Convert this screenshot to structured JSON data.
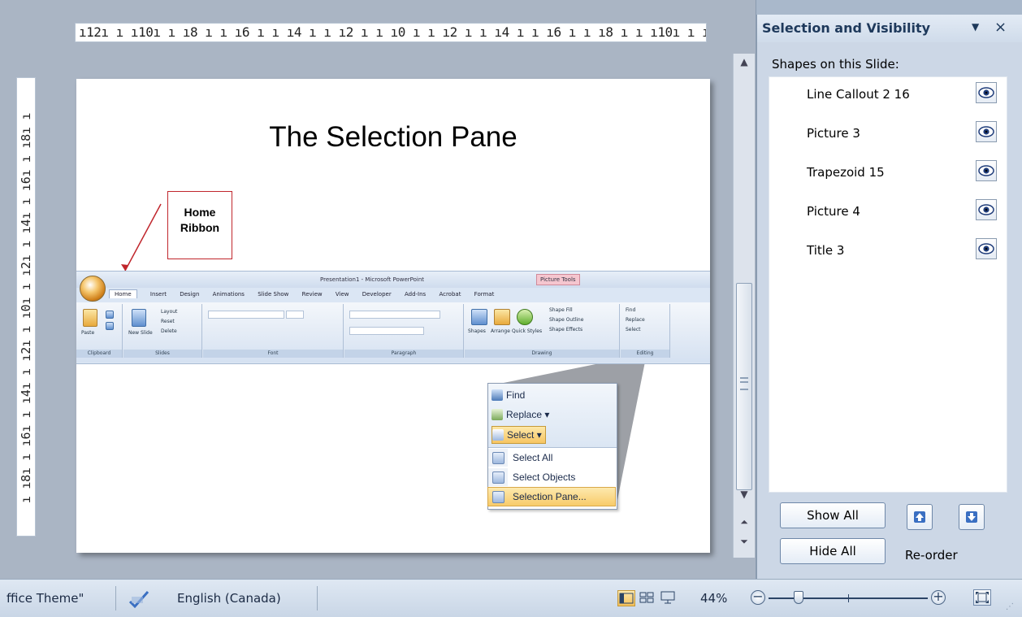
{
  "ruler": {
    "horizontal_text": "ı12ı ı ı10ı ı ı8 ı ı ı6 ı ı ı4 ı ı ı2 ı ı ı0 ı ı ı2 ı ı ı4 ı ı ı6 ı ı ı8 ı ı ı10ı ı ı12ı",
    "vertical_text": "ı ı8ı ı ı6ı ı ı4ı ı ı2ı ı ı0ı ı ı2ı ı ı4ı ı ı6ı ı ı8ı ı"
  },
  "slide": {
    "title": "The Selection Pane",
    "callout_line1": "Home",
    "callout_line2": "Ribbon",
    "ribbon_image": {
      "title_text": "Presentation1 - Microsoft PowerPoint",
      "context_tab": "Picture Tools",
      "tabs": [
        "Home",
        "Insert",
        "Design",
        "Animations",
        "Slide Show",
        "Review",
        "View",
        "Developer",
        "Add-Ins",
        "Acrobat",
        "Format"
      ],
      "groups": [
        "Clipboard",
        "Slides",
        "Font",
        "Paragraph",
        "Drawing",
        "Editing"
      ],
      "labels": {
        "paste": "Paste",
        "new_slide": "New Slide",
        "layout": "Layout",
        "reset": "Reset",
        "delete": "Delete",
        "shapes": "Shapes",
        "arrange": "Arrange",
        "quick_styles": "Quick Styles",
        "shape_fill": "Shape Fill",
        "shape_outline": "Shape Outline",
        "shape_effects": "Shape Effects",
        "find": "Find",
        "replace": "Replace",
        "select": "Select"
      }
    },
    "zoomed_menu": {
      "find": "Find",
      "replace": "Replace",
      "select": "Select",
      "items": [
        "Select All",
        "Select Objects",
        "Selection Pane..."
      ]
    }
  },
  "pane": {
    "title": "Selection and Visibility",
    "menu_glyph": "▼",
    "close_glyph": "×",
    "subtitle": "Shapes on this Slide:",
    "shapes": [
      {
        "name": "Line Callout 2 16",
        "visible": true
      },
      {
        "name": "Picture 3",
        "visible": true
      },
      {
        "name": "Trapezoid 15",
        "visible": true
      },
      {
        "name": "Picture 4",
        "visible": true
      },
      {
        "name": "Title 3",
        "visible": true
      }
    ],
    "show_all": "Show All",
    "hide_all": "Hide All",
    "reorder": "Re-order"
  },
  "statusbar": {
    "theme": "ffice Theme\"",
    "language": "English (Canada)",
    "zoom": "44%",
    "zoom_fraction": 0.44,
    "zoom_minus": "−",
    "zoom_plus": "+"
  },
  "colors": {
    "accent": "#1e395b",
    "highlight": "#f8cb6a",
    "callout_border": "#c0262c"
  }
}
